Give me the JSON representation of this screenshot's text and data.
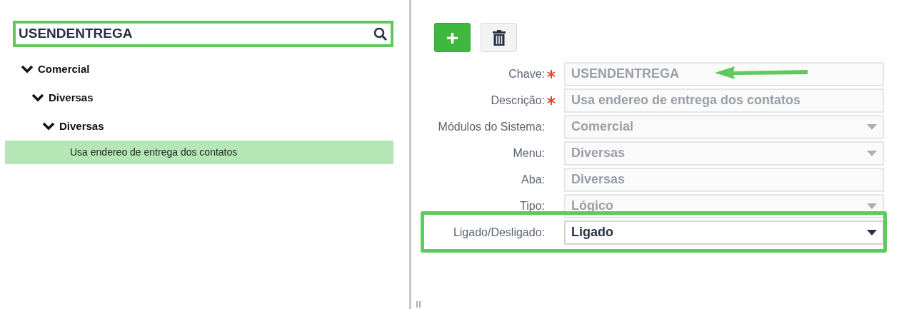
{
  "search": {
    "value": "USENDENTREGA"
  },
  "tree": [
    {
      "label": "Comercial",
      "expanded": true,
      "children": [
        {
          "label": "Diversas",
          "expanded": true,
          "children": [
            {
              "label": "Diversas",
              "expanded": true,
              "children": [
                {
                  "label": "Usa endereo de entrega dos contatos",
                  "selected": true
                }
              ]
            }
          ]
        }
      ]
    }
  ],
  "toolbar": {
    "add_label": "+"
  },
  "form": [
    {
      "label": "Chave:",
      "required": true,
      "kind": "text",
      "value": "USENDENTREGA",
      "disabled": true,
      "annotated": true
    },
    {
      "label": "Descrição:",
      "required": true,
      "kind": "text",
      "value": "Usa endereo de entrega dos contatos",
      "disabled": true,
      "annotated": false
    },
    {
      "label": "Módulos do Sistema:",
      "required": false,
      "kind": "select",
      "value": "Comercial",
      "disabled": true,
      "annotated": false
    },
    {
      "label": "Menu:",
      "required": false,
      "kind": "select",
      "value": "Diversas",
      "disabled": true,
      "annotated": false
    },
    {
      "label": "Aba:",
      "required": false,
      "kind": "text",
      "value": "Diversas",
      "disabled": true,
      "annotated": false
    },
    {
      "label": "Tipo:",
      "required": false,
      "kind": "select",
      "value": "Lógico",
      "disabled": true,
      "annotated": false
    },
    {
      "label": "Ligado/Desligado:",
      "required": false,
      "kind": "select",
      "value": "Ligado",
      "disabled": false,
      "annotated": false,
      "highlighted": true
    }
  ]
}
